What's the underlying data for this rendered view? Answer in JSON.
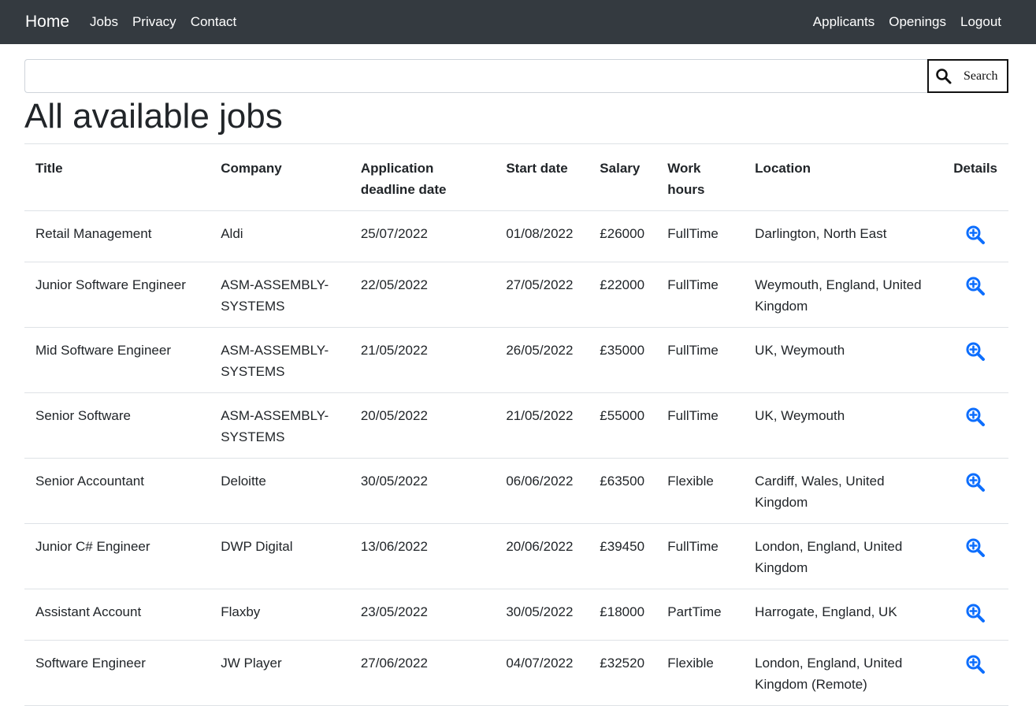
{
  "nav": {
    "brand": "Home",
    "left_links": [
      "Jobs",
      "Privacy",
      "Contact"
    ],
    "right_links": [
      "Applicants",
      "Openings",
      "Logout"
    ]
  },
  "search": {
    "value": "",
    "placeholder": "",
    "button_label": "Search",
    "button_icon": "search-icon"
  },
  "page": {
    "title": "All available jobs"
  },
  "table": {
    "headers": [
      "Title",
      "Company",
      "Application deadline date",
      "Start date",
      "Salary",
      "Work hours",
      "Location",
      "Details"
    ],
    "details_icon": "zoom-in-icon",
    "accent_color": "#0d6efd",
    "rows": [
      [
        "Retail Management",
        "Aldi",
        "25/07/2022",
        "01/08/2022",
        "£26000",
        "FullTime",
        "Darlington, North East"
      ],
      [
        "Junior Software Engineer",
        "ASM-ASSEMBLY-SYSTEMS",
        "22/05/2022",
        "27/05/2022",
        "£22000",
        "FullTime",
        "Weymouth, England, United Kingdom"
      ],
      [
        "Mid Software Engineer",
        "ASM-ASSEMBLY-SYSTEMS",
        "21/05/2022",
        "26/05/2022",
        "£35000",
        "FullTime",
        "UK, Weymouth"
      ],
      [
        "Senior Software",
        "ASM-ASSEMBLY-SYSTEMS",
        "20/05/2022",
        "21/05/2022",
        "£55000",
        "FullTime",
        "UK, Weymouth"
      ],
      [
        "Senior Accountant",
        "Deloitte",
        "30/05/2022",
        "06/06/2022",
        "£63500",
        "Flexible",
        "Cardiff, Wales, United Kingdom"
      ],
      [
        "Junior C# Engineer",
        "DWP Digital",
        "13/06/2022",
        "20/06/2022",
        "£39450",
        "FullTime",
        "London, England, United Kingdom"
      ],
      [
        "Assistant Account",
        "Flaxby",
        "23/05/2022",
        "30/05/2022",
        "£18000",
        "PartTime",
        "Harrogate, England, UK"
      ],
      [
        "Software Engineer",
        "JW Player",
        "27/06/2022",
        "04/07/2022",
        "£32520",
        "Flexible",
        "London, England, United Kingdom (Remote)"
      ]
    ]
  }
}
